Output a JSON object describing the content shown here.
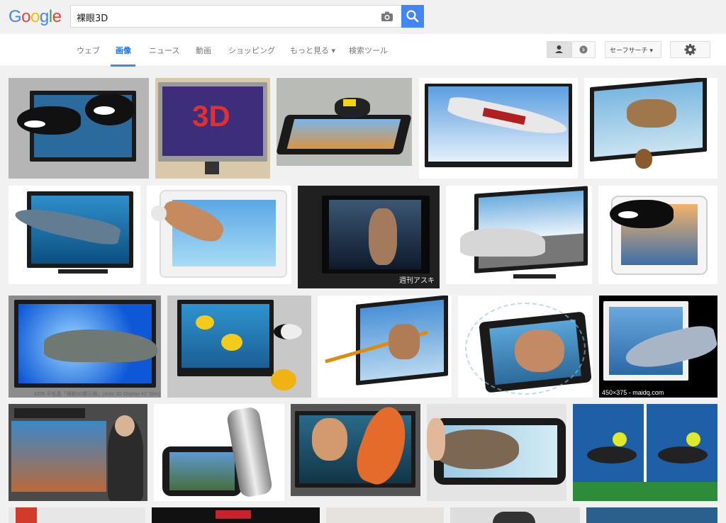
{
  "header": {
    "logo_letters": [
      "G",
      "o",
      "o",
      "g",
      "l",
      "e"
    ],
    "logo_colors": [
      "#4285f4",
      "#ea4335",
      "#fbbc05",
      "#4285f4",
      "#34a853",
      "#ea4335"
    ],
    "search_value": "裸眼3D"
  },
  "nav": {
    "tabs": [
      {
        "label": "ウェブ",
        "active": false
      },
      {
        "label": "画像",
        "active": true
      },
      {
        "label": "ニュース",
        "active": false
      },
      {
        "label": "動画",
        "active": false
      },
      {
        "label": "ショッピング",
        "active": false
      },
      {
        "label": "もっと見る ▾",
        "active": false
      },
      {
        "label": "検索ツール",
        "active": false
      }
    ],
    "safesearch_label": "セーフサーチ ▾"
  },
  "results": {
    "badge_text": "450×375 - maidq.com",
    "caption_text": "4205 平板晶「裸眼3D顯示器」(Acer 3D Display 42' 58m)",
    "watermark_text": "週刊アスキー"
  },
  "colors": {
    "accent": "#4285f4",
    "topbar_bg": "#f1f1f1"
  }
}
